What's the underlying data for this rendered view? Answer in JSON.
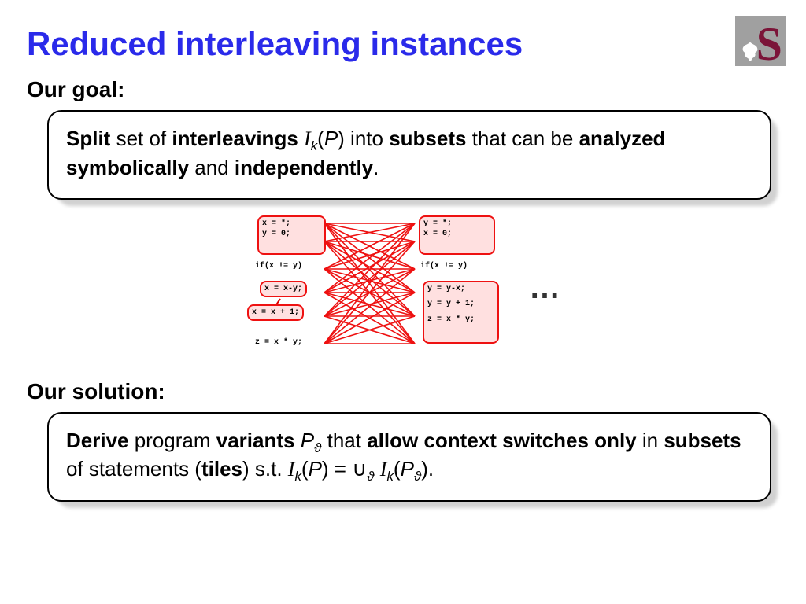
{
  "title": "Reduced interleaving instances",
  "logo": {
    "letter": "S"
  },
  "labels": {
    "goal": "Our goal:",
    "solution": "Our solution:"
  },
  "goal": {
    "t1": "Split",
    "t2": " set of ",
    "t3": "interleavings",
    "t4": " ",
    "t5": "I",
    "t6": "k",
    "t7": "(",
    "t8": "P",
    "t9": ") into ",
    "t10": "subsets",
    "t11": " that can be ",
    "t12": "analyzed symbolically",
    "t13": " and ",
    "t14": "independently",
    "t15": "."
  },
  "solution": {
    "t1": "Derive",
    "t2": " program ",
    "t3": "variants",
    "t4": " ",
    "t5": "P",
    "t6": "ϑ",
    "t7": " that ",
    "t8": "allow context switches only",
    "t9": " in ",
    "t10": "subsets",
    "t11": " of statements (",
    "t12": "tiles",
    "t13": ") s.t. ",
    "t14": "I",
    "t15": "k",
    "t16": "(",
    "t17": "P",
    "t18": ") = ∪",
    "t19": "ϑ",
    "t20": " ",
    "t21": "I",
    "t22": "k",
    "t23": "(",
    "t24": "P",
    "t25": "ϑ",
    "t26": ")."
  },
  "diagram": {
    "ellipsis": "…",
    "left": {
      "a": "x = *;",
      "b": "y = 0;",
      "c": "if(x != y)",
      "d": "x = x-y;",
      "e": "x = x + 1;",
      "f": "z = x * y;"
    },
    "right": {
      "a": "y = *;",
      "b": "x = 0;",
      "c": "if(x != y)",
      "d": "y = y-x;",
      "e": "y = y + 1;",
      "f": "z = x * y;"
    }
  }
}
